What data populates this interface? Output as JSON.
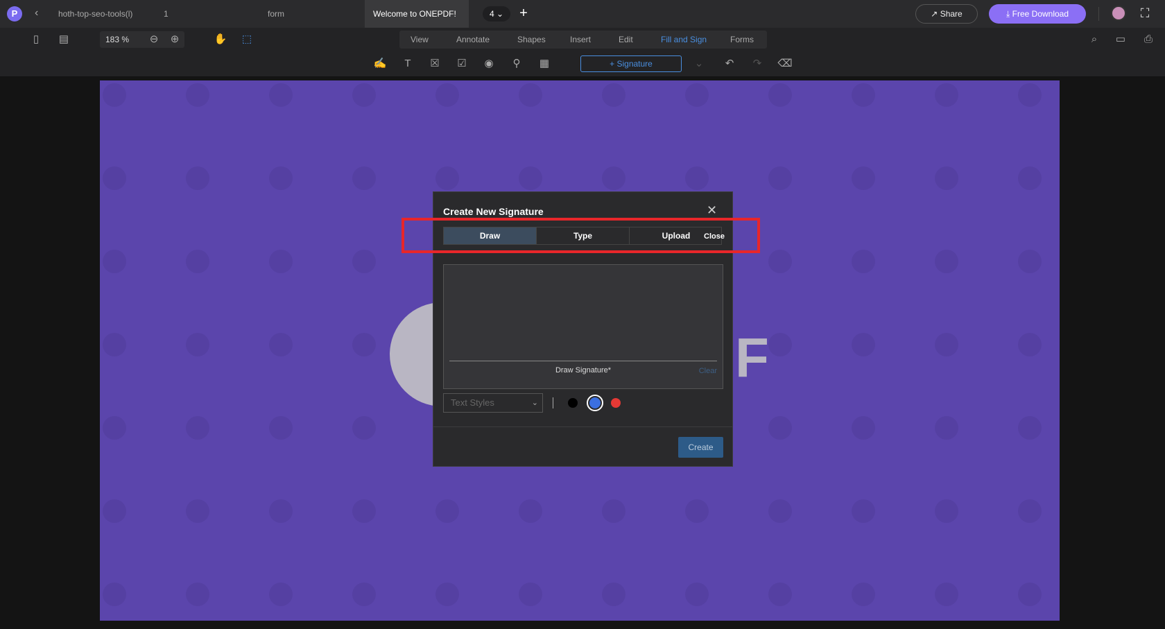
{
  "topbar": {
    "tabs": [
      "hoth-top-seo-tools(l)",
      "1",
      "form",
      "Welcome to ONEPDF!"
    ],
    "page_count": "4",
    "share_label": "Share",
    "download_label": "Free Download"
  },
  "toolbar": {
    "zoom": "183 %",
    "menu": [
      "View",
      "Annotate",
      "Shapes",
      "Insert",
      "Edit",
      "Fill and Sign",
      "Forms"
    ],
    "active_menu": "Fill and Sign",
    "signature_label": "+ Signature"
  },
  "canvas": {
    "bg_color": "#5b45ac",
    "logo_letter": "F"
  },
  "modal": {
    "title": "Create New Signature",
    "tabs": [
      "Draw",
      "Type",
      "Upload"
    ],
    "active_tab": "Draw",
    "close_label": "Close",
    "draw_label": "Draw Signature*",
    "clear_label": "Clear",
    "text_styles_placeholder": "Text Styles",
    "colors": [
      "#000000",
      "#3b6fe0",
      "#e53935"
    ],
    "selected_color": "#3b6fe0",
    "create_label": "Create"
  },
  "accent": "#8b6ff5",
  "highlight_color": "#e8262a"
}
